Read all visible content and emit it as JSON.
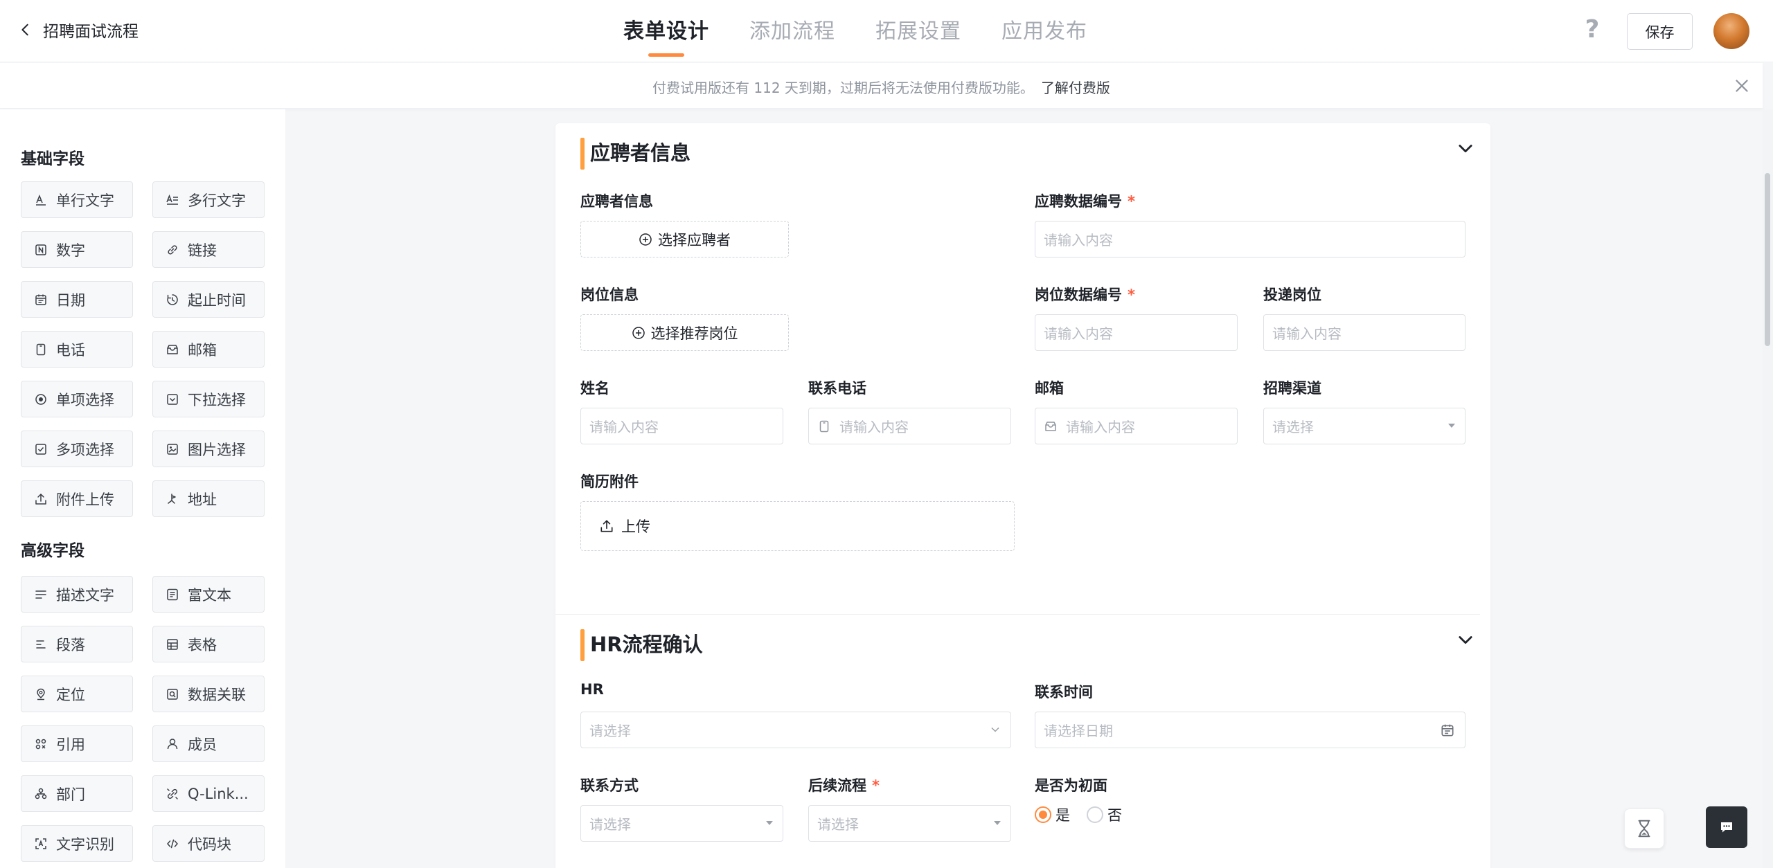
{
  "header": {
    "back_label": "招聘面试流程",
    "tabs": [
      {
        "label": "表单设计",
        "active": true
      },
      {
        "label": "添加流程",
        "active": false
      },
      {
        "label": "拓展设置",
        "active": false
      },
      {
        "label": "应用发布",
        "active": false
      }
    ],
    "help_label": "?",
    "save_label": "保存"
  },
  "banner": {
    "message": "付费试用版还有 112 天到期，过期后将无法使用付费版功能。",
    "link": "了解付费版"
  },
  "palette": {
    "basic_title": "基础字段",
    "basic": [
      {
        "label": "单行文字",
        "icon": "single-line-text-icon"
      },
      {
        "label": "多行文字",
        "icon": "multi-line-text-icon"
      },
      {
        "label": "数字",
        "icon": "number-icon"
      },
      {
        "label": "链接",
        "icon": "link-icon"
      },
      {
        "label": "日期",
        "icon": "date-icon"
      },
      {
        "label": "起止时间",
        "icon": "time-range-icon"
      },
      {
        "label": "电话",
        "icon": "phone-icon"
      },
      {
        "label": "邮箱",
        "icon": "email-icon"
      },
      {
        "label": "单项选择",
        "icon": "radio-icon"
      },
      {
        "label": "下拉选择",
        "icon": "dropdown-icon"
      },
      {
        "label": "多项选择",
        "icon": "checkbox-icon"
      },
      {
        "label": "图片选择",
        "icon": "image-icon"
      },
      {
        "label": "附件上传",
        "icon": "upload-icon"
      },
      {
        "label": "地址",
        "icon": "address-icon"
      }
    ],
    "advanced_title": "高级字段",
    "advanced": [
      {
        "label": "描述文字",
        "icon": "description-icon"
      },
      {
        "label": "富文本",
        "icon": "rich-text-icon"
      },
      {
        "label": "段落",
        "icon": "paragraph-icon"
      },
      {
        "label": "表格",
        "icon": "table-icon"
      },
      {
        "label": "定位",
        "icon": "location-icon"
      },
      {
        "label": "数据关联",
        "icon": "data-link-icon"
      },
      {
        "label": "引用",
        "icon": "reference-icon"
      },
      {
        "label": "成员",
        "icon": "member-icon"
      },
      {
        "label": "部门",
        "icon": "department-icon"
      },
      {
        "label": "Q-Link...",
        "icon": "qlink-icon"
      },
      {
        "label": "文字识别",
        "icon": "ocr-icon"
      },
      {
        "label": "代码块",
        "icon": "code-icon"
      }
    ]
  },
  "form": {
    "group1": {
      "title": "应聘者信息",
      "applicant_label": "应聘者信息",
      "applicant_button": "选择应聘者",
      "applicant_no_label": "应聘数据编号",
      "applicant_no_placeholder": "请输入内容",
      "position_label": "岗位信息",
      "position_button": "选择推荐岗位",
      "position_no_label": "岗位数据编号",
      "position_no_placeholder": "请输入内容",
      "apply_position_label": "投递岗位",
      "apply_position_placeholder": "请输入内容",
      "name_label": "姓名",
      "name_placeholder": "请输入内容",
      "phone_label": "联系电话",
      "phone_placeholder": "请输入内容",
      "email_label": "邮箱",
      "email_placeholder": "请输入内容",
      "channel_label": "招聘渠道",
      "channel_placeholder": "请选择",
      "resume_label": "简历附件",
      "resume_button": "上传"
    },
    "group2": {
      "title": "HR流程确认",
      "hr_label": "HR",
      "hr_placeholder": "请选择",
      "contact_time_label": "联系时间",
      "contact_time_placeholder": "请选择日期",
      "contact_method_label": "联系方式",
      "contact_method_placeholder": "请选择",
      "next_process_label": "后续流程",
      "next_process_placeholder": "请选择",
      "first_interview_label": "是否为初面",
      "yes_label": "是",
      "no_label": "否"
    },
    "required_mark": "*"
  },
  "colors": {
    "accent": "#ff8a3d",
    "required": "#ff5a3d"
  }
}
